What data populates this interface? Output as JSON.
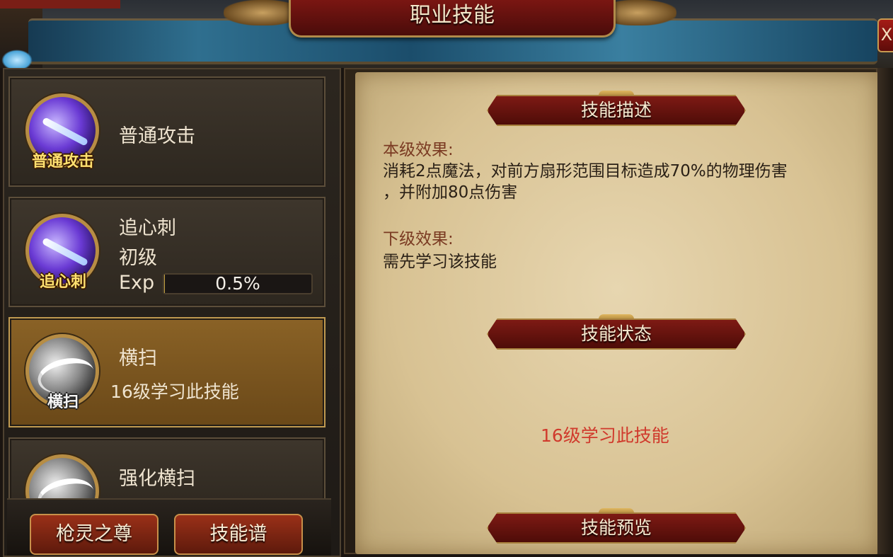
{
  "window": {
    "title": "职业技能",
    "close_label": "X"
  },
  "skills": [
    {
      "icon_label": "普通攻击",
      "name": "普通攻击"
    },
    {
      "icon_label": "追心刺",
      "name": "追心刺",
      "level": "初级",
      "exp_label": "Exp",
      "exp_text": "0.5%",
      "exp_fraction": 0.005
    },
    {
      "icon_label": "横扫",
      "name": "横扫",
      "requirement": "16级学习此技能",
      "selected": true
    },
    {
      "name": "强化横扫"
    }
  ],
  "bottom_buttons": [
    "枪灵之尊",
    "技能谱"
  ],
  "detail": {
    "desc_header": "技能描述",
    "current_label": "本级效果:",
    "current_text_line1": "消耗2点魔法，对前方扇形范围目标造成70%的物理伤害",
    "current_text_line2": "，并附加80点伤害",
    "next_label": "下级效果:",
    "next_text": "需先学习该技能",
    "status_header": "技能状态",
    "status_text": "16级学习此技能",
    "preview_header": "技能预览"
  }
}
